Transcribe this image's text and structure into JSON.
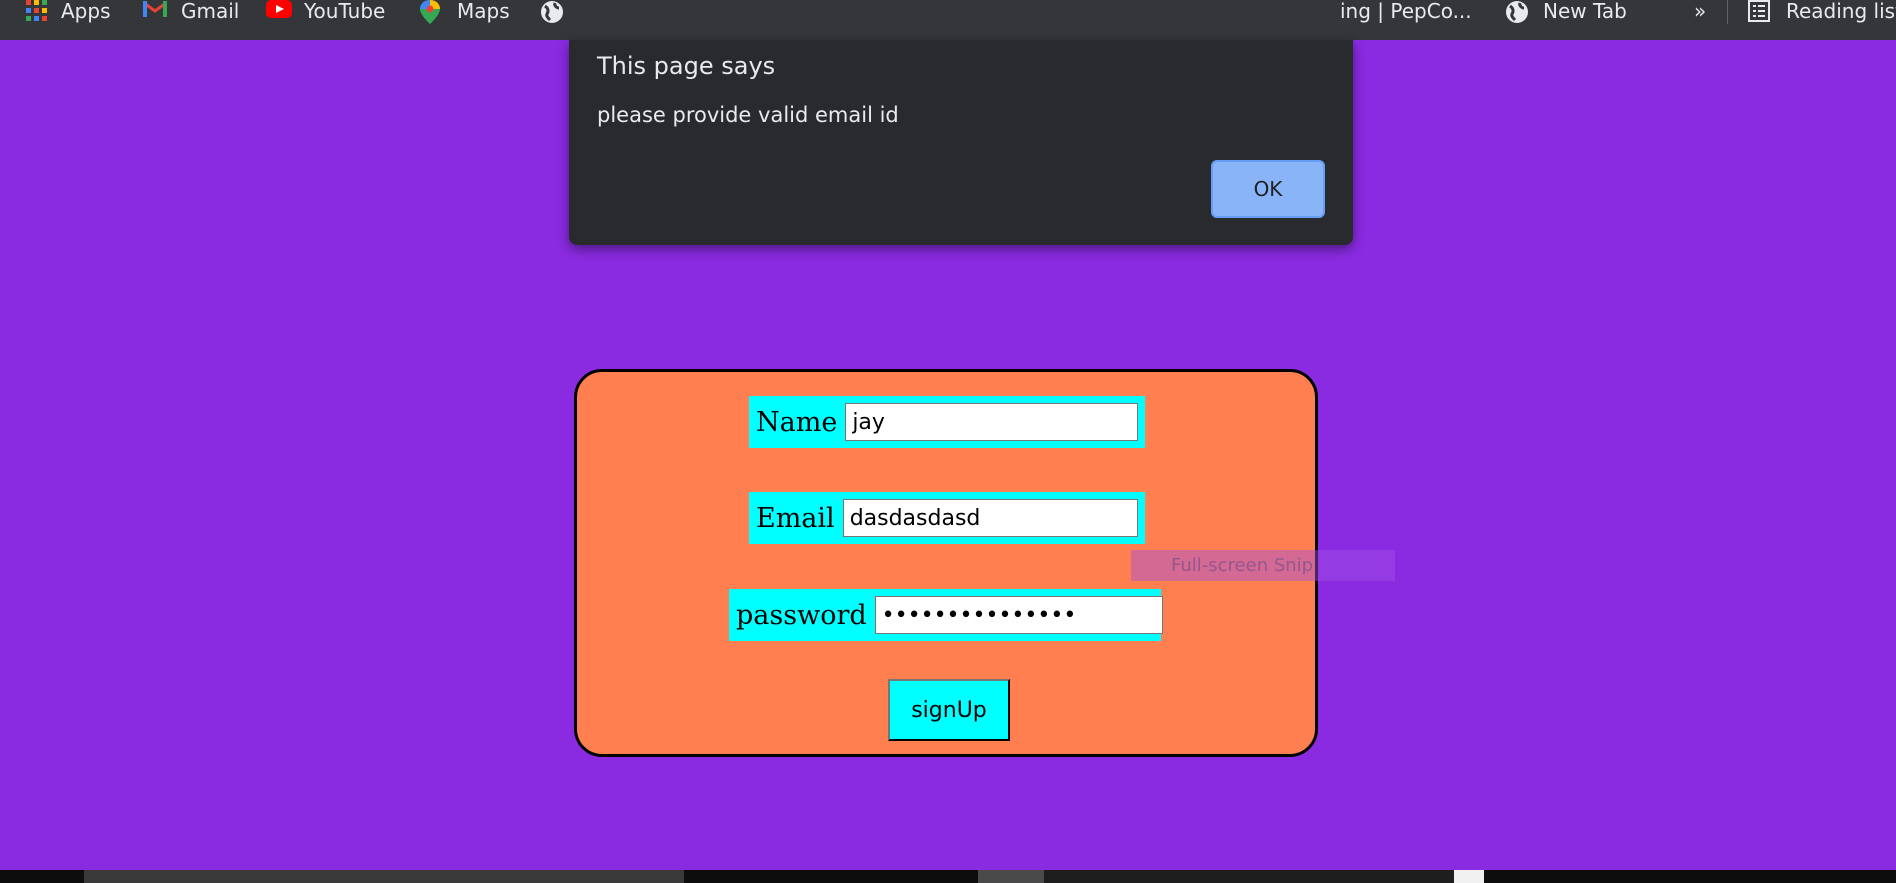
{
  "bookmarks": [
    {
      "label": "Apps",
      "icon": "apps-icon"
    },
    {
      "label": "Gmail",
      "icon": "gmail-icon"
    },
    {
      "label": "YouTube",
      "icon": "youtube-icon"
    },
    {
      "label": "Maps",
      "icon": "maps-icon"
    },
    {
      "label": "ing | PepCo...",
      "icon": "globe-icon"
    },
    {
      "label": "New Tab",
      "icon": "globe-icon"
    },
    {
      "label": "»",
      "icon": "chevron-more-icon"
    },
    {
      "label": "Reading list",
      "icon": "reading-list-icon"
    }
  ],
  "dialog": {
    "title": "This page says",
    "message": "please provide valid email id",
    "ok_label": "OK"
  },
  "form": {
    "name": {
      "label": "Name",
      "value": "jay"
    },
    "email": {
      "label": "Email",
      "value": "dasdasdasd"
    },
    "password": {
      "label": "password",
      "value": "•••••••••••••••"
    },
    "submit_label": "signUp"
  },
  "snip_overlay": {
    "text": "Full-screen Snip"
  },
  "colors": {
    "page_background": "#8a2be2",
    "card_background": "#ff7f50",
    "field_background": "#00ffff",
    "dialog_background": "#292a2d",
    "dialog_button": "#8ab4f8"
  }
}
